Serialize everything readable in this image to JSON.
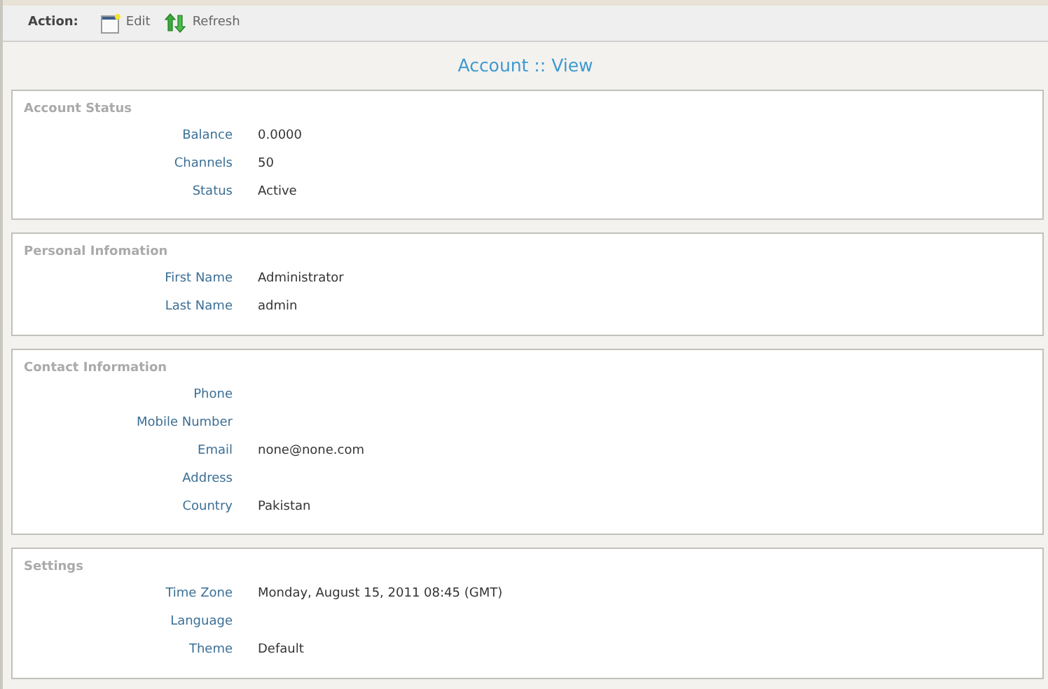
{
  "toolbar": {
    "label": "Action:",
    "actions": [
      {
        "kind": "edit",
        "label": "Edit"
      },
      {
        "kind": "refresh",
        "label": "Refresh"
      }
    ]
  },
  "page_title": "Account :: View",
  "sections": [
    {
      "title": "Account Status",
      "rows": [
        {
          "label": "Balance",
          "value": "0.0000"
        },
        {
          "label": "Channels",
          "value": "50"
        },
        {
          "label": "Status",
          "value": "Active"
        }
      ]
    },
    {
      "title": "Personal Infomation",
      "rows": [
        {
          "label": "First Name",
          "value": "Administrator"
        },
        {
          "label": "Last Name",
          "value": "admin"
        }
      ]
    },
    {
      "title": "Contact Information",
      "rows": [
        {
          "label": "Phone"
        },
        {
          "label": "Mobile Number"
        },
        {
          "label": "Email",
          "value": "none@none.com"
        },
        {
          "label": "Address"
        },
        {
          "label": "Country",
          "value": "Pakistan"
        }
      ]
    },
    {
      "title": "Settings",
      "rows": [
        {
          "label": "Time Zone",
          "value": "Monday, August 15, 2011 08:45 (GMT)"
        },
        {
          "label": "Language"
        },
        {
          "label": "Theme",
          "value": "Default"
        }
      ]
    }
  ]
}
